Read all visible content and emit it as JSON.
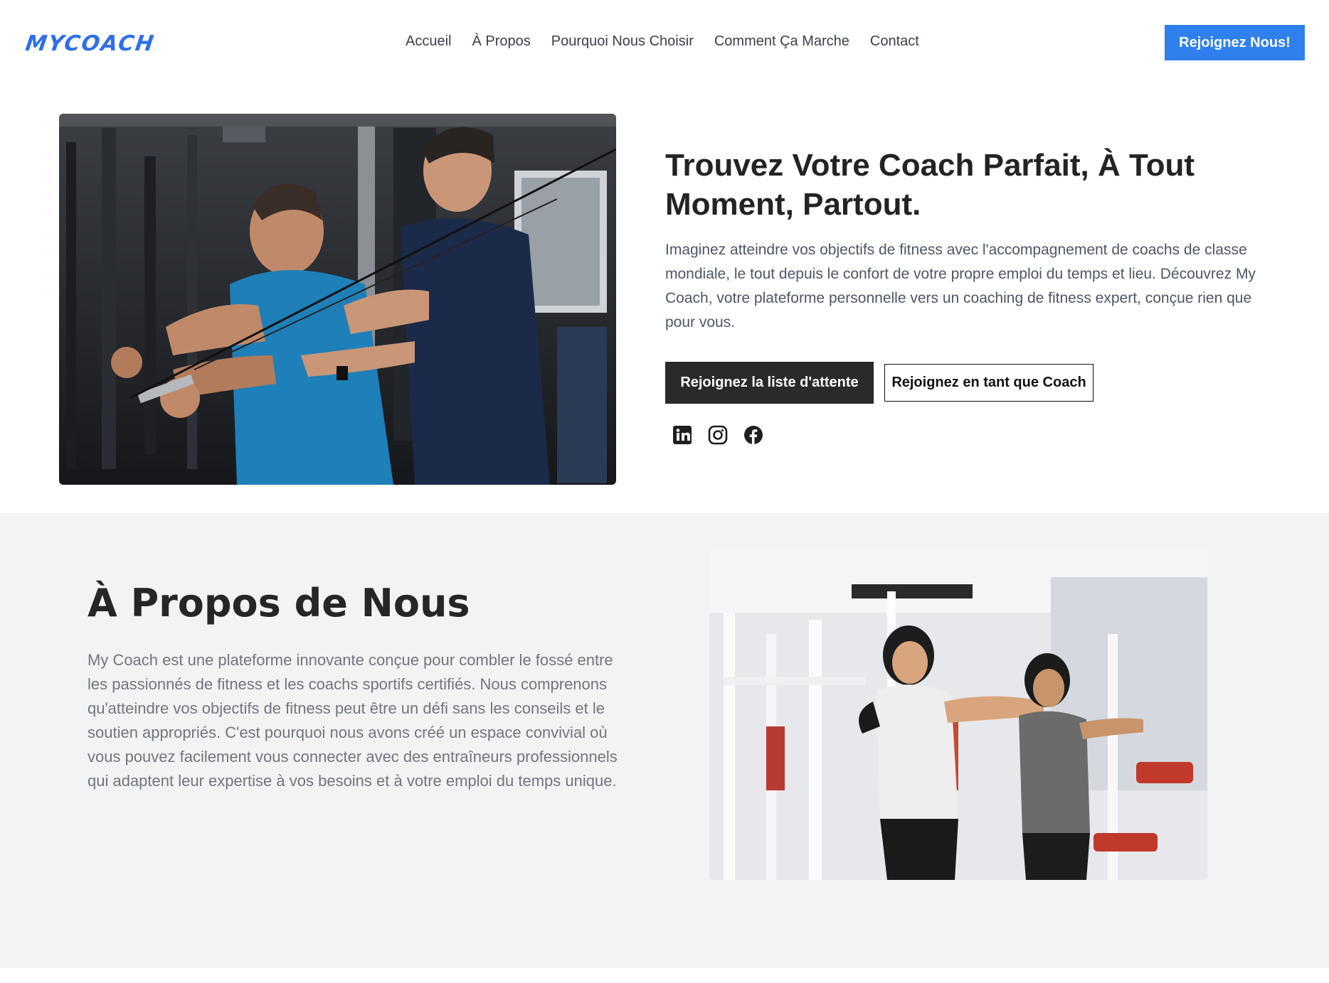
{
  "header": {
    "logo": "MYCOACH",
    "nav": [
      "Accueil",
      "À Propos",
      "Pourquoi Nous Choisir",
      "Comment Ça Marche",
      "Contact"
    ],
    "cta_label": "Rejoignez Nous!"
  },
  "hero": {
    "title": "Trouvez Votre Coach Parfait, À Tout Moment, Partout.",
    "description": "Imaginez atteindre vos objectifs de fitness avec l'accompagnement de coachs de classe mondiale, le tout depuis le confort de votre propre emploi du temps et lieu. Découvrez My Coach, votre plateforme personnelle vers un coaching de fitness expert, conçue rien que pour vous.",
    "btn_waitlist": "Rejoignez la liste d'attente",
    "btn_coach": "Rejoignez en tant que Coach",
    "socials": [
      "linkedin-icon",
      "instagram-icon",
      "facebook-icon"
    ]
  },
  "about": {
    "title": "À Propos de Nous",
    "text": "My Coach est une plateforme innovante conçue pour combler le fossé entre les passionnés de fitness et les coachs sportifs certifiés. Nous comprenons qu'atteindre vos objectifs de fitness peut être un défi sans les conseils et le soutien appropriés. C'est pourquoi nous avons créé un espace convivial où vous pouvez facilement vous connecter avec des entraîneurs professionnels qui adaptent leur expertise à vos besoins et à votre emploi du temps unique."
  },
  "colors": {
    "accent": "#2f80ed",
    "logo": "#2f6fe6",
    "dark_button": "#2a2a2a",
    "section_bg": "#f3f3f3"
  }
}
